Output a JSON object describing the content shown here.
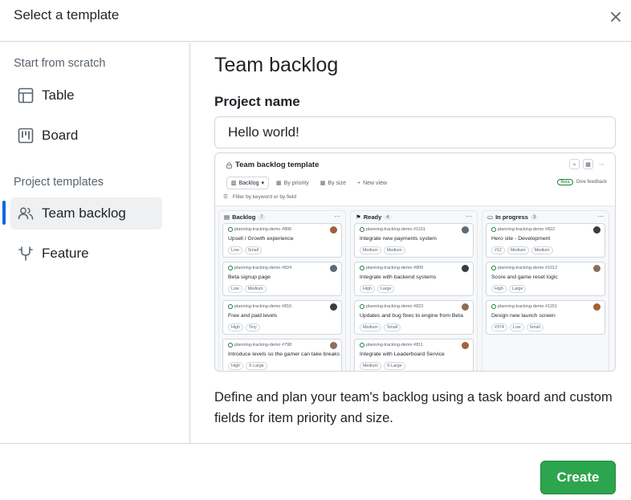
{
  "dialog": {
    "title": "Select a template",
    "close_icon": "x-icon"
  },
  "sidebar": {
    "scratch_label": "Start from scratch",
    "scratch_items": [
      {
        "label": "Table",
        "icon": "table-icon"
      },
      {
        "label": "Board",
        "icon": "board-icon"
      }
    ],
    "templates_label": "Project templates",
    "template_items": [
      {
        "label": "Team backlog",
        "icon": "people-icon",
        "selected": true
      },
      {
        "label": "Feature",
        "icon": "beaker-icon",
        "selected": false
      }
    ],
    "accent_color": "#0969da"
  },
  "main": {
    "heading": "Team backlog",
    "field_label": "Project name",
    "project_name_value": "Hello world!",
    "description": "Define and plan your team's backlog using a task board and custom fields for item priority and size."
  },
  "preview": {
    "title": "Team backlog template",
    "tabs": [
      {
        "label": "Backlog"
      },
      {
        "label": "By priority"
      },
      {
        "label": "By size"
      },
      {
        "label": "New view"
      }
    ],
    "beta_badge": "Beta",
    "feedback_label": "Give feedback",
    "filter_placeholder": "Filter by keyword or by field",
    "columns": [
      {
        "name": "Backlog",
        "count": "7",
        "cards": [
          {
            "ref": "planning-tracking-demo #806",
            "title": "Upsell / Growth experience",
            "tags": [
              "Low",
              "Small"
            ]
          },
          {
            "ref": "planning-tracking-demo #824",
            "title": "Beta signup page",
            "tags": [
              "Low",
              "Medium"
            ]
          },
          {
            "ref": "planning-tracking-demo #816",
            "title": "Free and paid levels",
            "tags": [
              "High",
              "Tiny"
            ]
          },
          {
            "ref": "planning-tracking-demo #798",
            "title": "Introduce levels so the gamer can take breaks",
            "tags": [
              "High",
              "X-Large"
            ]
          }
        ]
      },
      {
        "name": "Ready",
        "count": "4",
        "cards": [
          {
            "ref": "planning-tracking-demo #1101",
            "title": "Integrate new payments system",
            "tags": [
              "Medium",
              "Medium"
            ]
          },
          {
            "ref": "planning-tracking-demo #809",
            "title": "Integrate with backend systems",
            "tags": [
              "High",
              "Large"
            ]
          },
          {
            "ref": "planning-tracking-demo #823",
            "title": "Updates and bug fixes to engine from Beta",
            "tags": [
              "Medium",
              "Small"
            ]
          },
          {
            "ref": "planning-tracking-demo #811",
            "title": "Integrate with Leaderboard Service",
            "tags": [
              "Medium",
              "X-Large"
            ]
          }
        ]
      },
      {
        "name": "In progress",
        "count": "3",
        "cards": [
          {
            "ref": "planning-tracking-demo #822",
            "title": "Hero site - Development",
            "tags": [
              "#12",
              "Medium",
              "Medium"
            ]
          },
          {
            "ref": "planning-tracking-demo #1012",
            "title": "Score and game reset logic",
            "tags": [
              "High",
              "Large"
            ]
          },
          {
            "ref": "planning-tracking-demo #1151",
            "title": "Design new launch screen",
            "tags": [
              "#374",
              "Low",
              "Small"
            ]
          }
        ]
      }
    ]
  },
  "footer": {
    "create_label": "Create",
    "create_color": "#2da44e"
  }
}
